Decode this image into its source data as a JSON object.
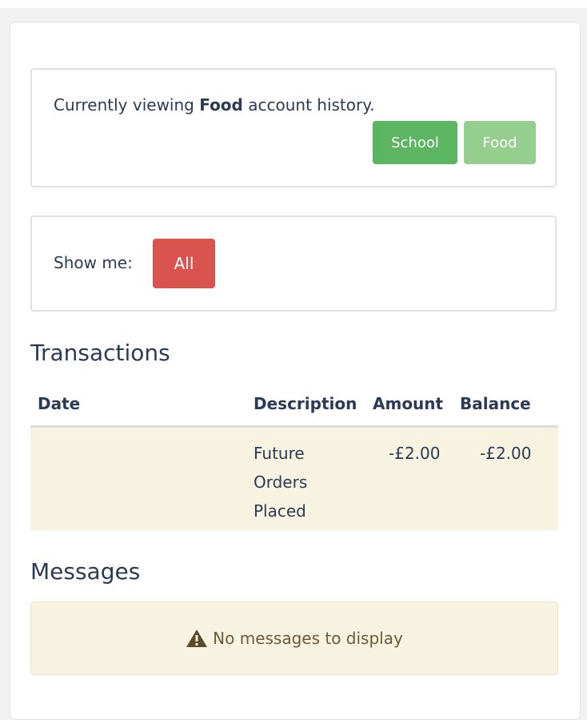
{
  "account": {
    "prefix": "Currently viewing ",
    "name": "Food",
    "suffix": " account history.",
    "buttons": [
      "School",
      "Food"
    ]
  },
  "filter": {
    "label": "Show me:",
    "selected": "All"
  },
  "transactions": {
    "title": "Transactions",
    "columns": [
      "Date",
      "Description",
      "Amount",
      "Balance"
    ],
    "rows": [
      {
        "date": "",
        "description": "Future Orders Placed",
        "amount": "-£2.00",
        "balance": "-£2.00"
      }
    ]
  },
  "messages": {
    "title": "Messages",
    "empty_text": "No messages to display"
  },
  "icons": {
    "warning": "warning-triangle-icon"
  },
  "colors": {
    "school_button": "#5cb560",
    "food_button": "#95cf8e",
    "all_button": "#d9534f",
    "row_bg": "#f8f3e0"
  }
}
